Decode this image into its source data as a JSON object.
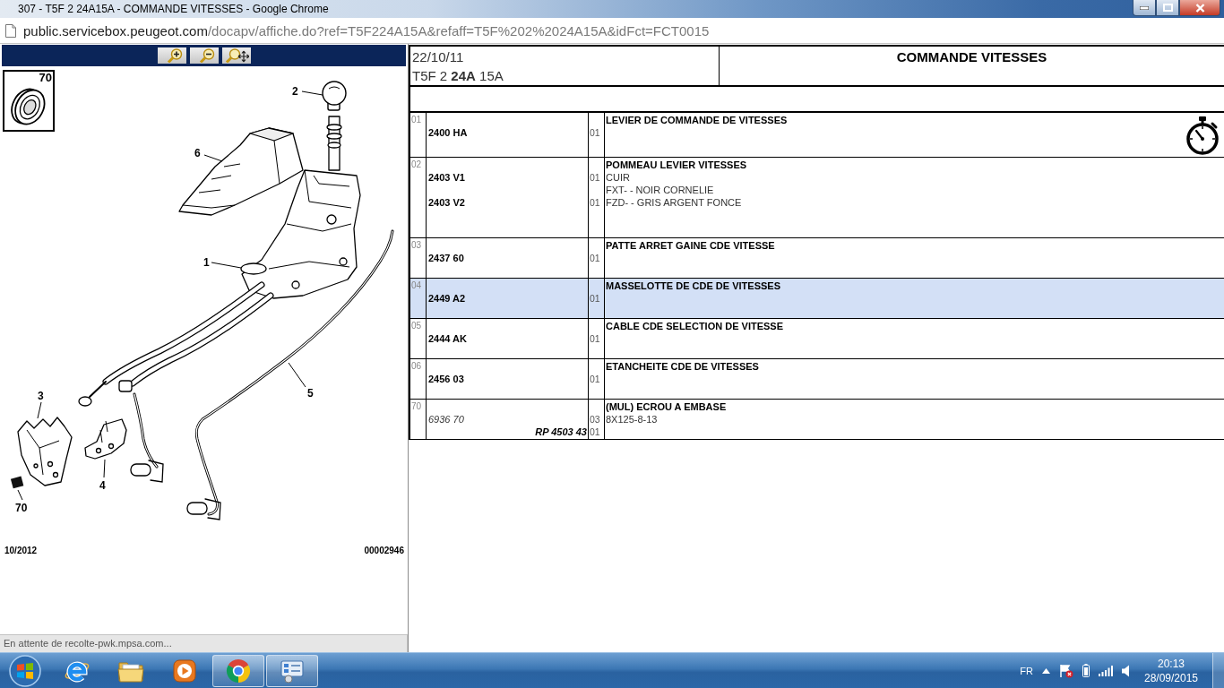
{
  "window": {
    "title": "307 - T5F 2 24A15A - COMMANDE VITESSES - Google Chrome"
  },
  "address_bar": {
    "host": "public.servicebox.peugeot.com",
    "path": "/docapv/affiche.do?ref=T5F224A15A&refaff=T5F%202%2024A15A&idFct=FCT0015"
  },
  "illustration": {
    "inset_label": "70",
    "callouts": [
      "2",
      "6",
      "1",
      "5",
      "3",
      "4",
      "70"
    ],
    "date": "10/2012",
    "number": "00002946"
  },
  "status_bubble": "En attente de recolte-pwk.mpsa.com...",
  "header": {
    "date": "22/10/11",
    "code": "T5F 2 **24A** 15A",
    "title": "COMMANDE VITESSES"
  },
  "parts": [
    {
      "index": "01",
      "title": "LEVIER DE COMMANDE DE VITESSES",
      "timed": true,
      "selected": false,
      "lines": [
        {
          "kind": "part",
          "ref": "2400 HA",
          "qty": "01"
        }
      ]
    },
    {
      "index": "02",
      "title": "POMMEAU LEVIER VITESSES",
      "timed": false,
      "selected": false,
      "lines": [
        {
          "kind": "part",
          "ref": "2403 V1",
          "qty": "01",
          "text": "CUIR"
        },
        {
          "kind": "part",
          "text": "FXT- - NOIR CORNELIE"
        },
        {
          "kind": "part",
          "ref": "2403 V2",
          "qty": "01",
          "text": "FZD- - GRIS ARGENT FONCE"
        }
      ]
    },
    {
      "index": "03",
      "title": "PATTE ARRET GAINE CDE VITESSE",
      "timed": false,
      "selected": false,
      "lines": [
        {
          "kind": "part",
          "ref": "2437 60",
          "qty": "01"
        }
      ]
    },
    {
      "index": "04",
      "title": "MASSELOTTE DE CDE DE VITESSES",
      "timed": false,
      "selected": true,
      "lines": [
        {
          "kind": "part",
          "ref": "2449 A2",
          "qty": "01"
        }
      ]
    },
    {
      "index": "05",
      "title": "CABLE CDE SELECTION DE VITESSE",
      "timed": false,
      "selected": false,
      "lines": [
        {
          "kind": "part",
          "ref": "2444 AK",
          "qty": "01"
        }
      ]
    },
    {
      "index": "06",
      "title": "ETANCHEITE CDE DE VITESSES",
      "timed": false,
      "selected": false,
      "lines": [
        {
          "kind": "part",
          "ref": "2456 03",
          "qty": "01"
        }
      ]
    },
    {
      "index": "70",
      "title": "(MUL) ECROU A EMBASE",
      "timed": false,
      "selected": false,
      "lines": [
        {
          "kind": "superseded",
          "ref": "6936 70",
          "qty": "03",
          "text": "8X125-8-13"
        },
        {
          "kind": "replacement",
          "ref": "RP 4503 43",
          "qty": "01"
        }
      ]
    }
  ],
  "taskbar": {
    "apps": [
      {
        "kind": "globe",
        "running": false
      },
      {
        "kind": "folder",
        "running": false
      },
      {
        "kind": "player",
        "running": false
      },
      {
        "kind": "wheel",
        "running": true
      },
      {
        "kind": "panel",
        "running": true
      }
    ],
    "language": "FR",
    "time": "20:13",
    "date": "28/09/2015"
  }
}
